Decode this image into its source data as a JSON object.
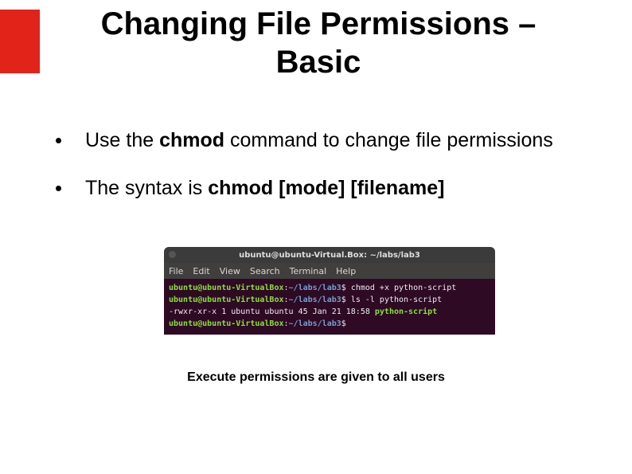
{
  "title": "Changing File Permissions – Basic",
  "bullets": [
    {
      "prefix": "Use the ",
      "bold1": "chmod",
      "suffix": " command to change file permissions"
    },
    {
      "prefix": "The syntax is ",
      "bold1": "chmod [mode] [filename]",
      "suffix": ""
    }
  ],
  "terminal": {
    "titlebar": "ubuntu@ubuntu-Virtual.Box: ~/labs/lab3",
    "menu": [
      "File",
      "Edit",
      "View",
      "Search",
      "Terminal",
      "Help"
    ],
    "lines": [
      {
        "user": "ubuntu@ubuntu-VirtualBox",
        "colon": ":",
        "path": "~/labs/lab3",
        "dollar": "$ ",
        "cmd": "chmod +x python-script"
      },
      {
        "user": "ubuntu@ubuntu-VirtualBox",
        "colon": ":",
        "path": "~/labs/lab3",
        "dollar": "$ ",
        "cmd": "ls -l python-script"
      },
      {
        "perm": "-rwxr-xr-x 1 ubuntu ubuntu 45 Jan 21 18:58 ",
        "file": "python-script"
      },
      {
        "user": "ubuntu@ubuntu-VirtualBox",
        "colon": ":",
        "path": "~/labs/lab3",
        "dollar": "$ ",
        "cmd": ""
      }
    ]
  },
  "caption": "Execute permissions are given to all users"
}
